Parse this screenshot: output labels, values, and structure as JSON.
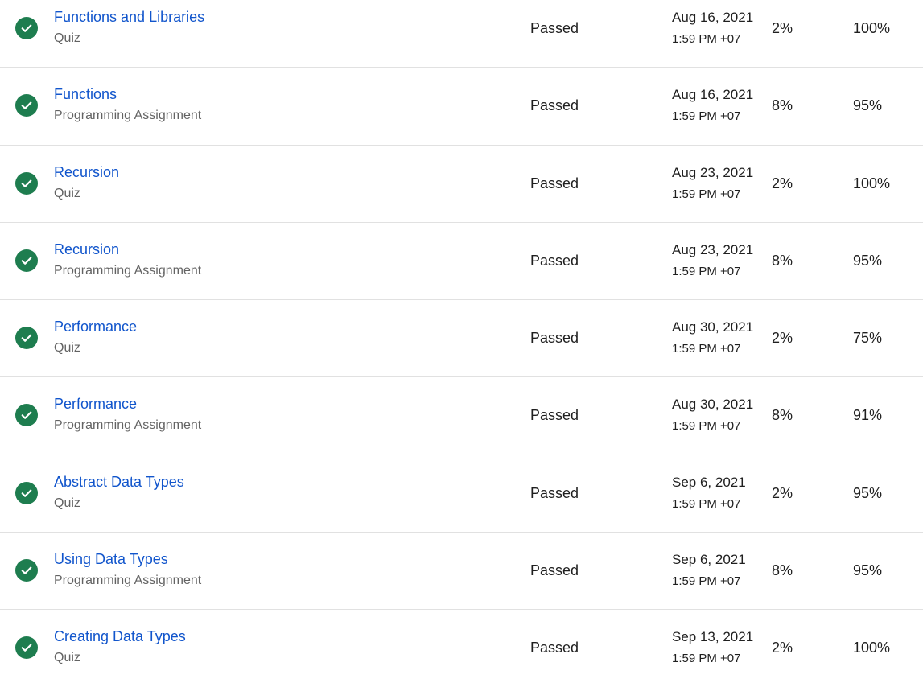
{
  "colors": {
    "passed_icon": "#1e7d4f",
    "link": "#1155cc",
    "secondary_text": "#636363",
    "divider": "#e1e1e1"
  },
  "status_icon_name": "check-circle-icon",
  "rows": [
    {
      "title": "Functions and Libraries",
      "type": "Quiz",
      "status": "Passed",
      "due_date": "Aug 16, 2021",
      "due_time": "1:59 PM +07",
      "weight": "2%",
      "grade": "100%"
    },
    {
      "title": "Functions",
      "type": "Programming Assignment",
      "status": "Passed",
      "due_date": "Aug 16, 2021",
      "due_time": "1:59 PM +07",
      "weight": "8%",
      "grade": "95%"
    },
    {
      "title": "Recursion",
      "type": "Quiz",
      "status": "Passed",
      "due_date": "Aug 23, 2021",
      "due_time": "1:59 PM +07",
      "weight": "2%",
      "grade": "100%"
    },
    {
      "title": "Recursion",
      "type": "Programming Assignment",
      "status": "Passed",
      "due_date": "Aug 23, 2021",
      "due_time": "1:59 PM +07",
      "weight": "8%",
      "grade": "95%"
    },
    {
      "title": "Performance",
      "type": "Quiz",
      "status": "Passed",
      "due_date": "Aug 30, 2021",
      "due_time": "1:59 PM +07",
      "weight": "2%",
      "grade": "75%"
    },
    {
      "title": "Performance",
      "type": "Programming Assignment",
      "status": "Passed",
      "due_date": "Aug 30, 2021",
      "due_time": "1:59 PM +07",
      "weight": "8%",
      "grade": "91%"
    },
    {
      "title": "Abstract Data Types",
      "type": "Quiz",
      "status": "Passed",
      "due_date": "Sep 6, 2021",
      "due_time": "1:59 PM +07",
      "weight": "2%",
      "grade": "95%"
    },
    {
      "title": "Using Data Types",
      "type": "Programming Assignment",
      "status": "Passed",
      "due_date": "Sep 6, 2021",
      "due_time": "1:59 PM +07",
      "weight": "8%",
      "grade": "95%"
    },
    {
      "title": "Creating Data Types",
      "type": "Quiz",
      "status": "Passed",
      "due_date": "Sep 13, 2021",
      "due_time": "1:59 PM +07",
      "weight": "2%",
      "grade": "100%"
    }
  ]
}
